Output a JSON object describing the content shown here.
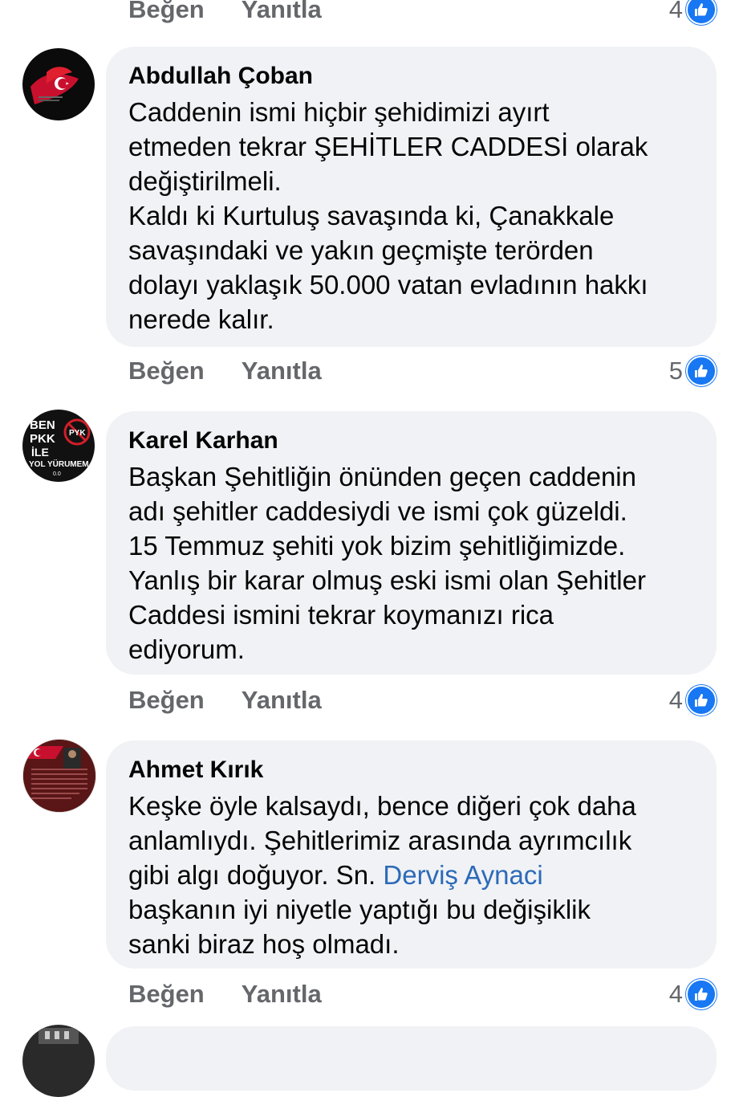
{
  "actions": {
    "like_label": "Beğen",
    "reply_label": "Yanıtla"
  },
  "comments": [
    {
      "author": "Abdullah Çoban",
      "lines": [
        "Caddenin ismi hiçbir şehidimizi ayırt",
        "etmeden tekrar ŞEHİTLER CADDESİ olarak",
        "değiştirilmeli.",
        "Kaldı ki Kurtuluş savaşında ki, Çanakkale",
        "savaşındaki ve yakın geçmişte terörden",
        "dolayı yaklaşık 50.000 vatan evladının hakkı",
        "nerede kalır."
      ],
      "like_count": "5"
    },
    {
      "author": "Karel Karhan",
      "avatar_text": {
        "l1": "BEN",
        "l2": "PKK",
        "l3": "İLE",
        "l4": "YOL YÜRUMEM",
        "l5": "0.0",
        "badge": "PYK"
      },
      "lines": [
        "Başkan Şehitliğin önünden geçen caddenin",
        "adı şehitler caddesiydi ve ismi çok güzeldi.",
        "15 Temmuz şehiti yok bizim şehitliğimizde.",
        "Yanlış bir karar olmuş eski ismi olan Şehitler",
        "Caddesi ismini tekrar koymanızı rica",
        "ediyorum."
      ],
      "like_count": "4"
    },
    {
      "author": "Ahmet Kırık",
      "lines": {
        "l1": "Keşke öyle kalsaydı, bence diğeri çok daha",
        "l2": "anlamlıydı. Şehitlerimiz arasında ayrımcılık",
        "l3_pre": "gibi algı doğuyor. Sn. ",
        "l3_mention": "Derviş Aynaci",
        "l4": "başkanın iyi niyetle yaptığı bu değişiklik",
        "l5": "sanki biraz hoş olmadı."
      },
      "like_count": "4"
    }
  ],
  "top_like_count": "4",
  "colors": {
    "link_gray": "#65676b",
    "bubble_bg": "#f0f2f5",
    "like_blue": "#1877f2",
    "mention_blue": "#2d6ab8"
  },
  "icons": [
    "thumbs-up-icon"
  ]
}
